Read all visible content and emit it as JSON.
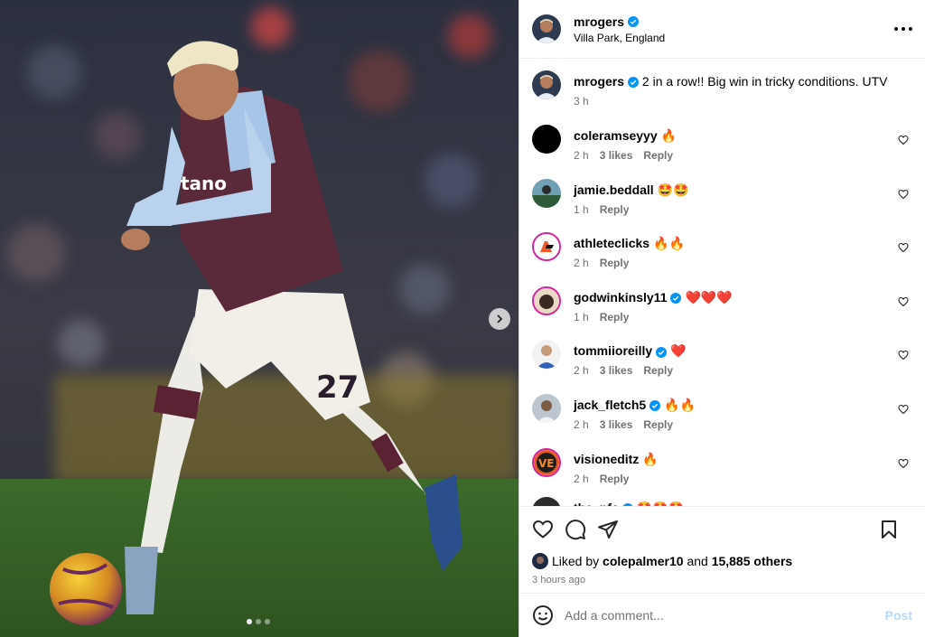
{
  "author": {
    "username": "mrogers",
    "location": "Villa Park, England",
    "verified": true
  },
  "caption": {
    "username": "mrogers",
    "text": "2 in a row!! Big win in tricky conditions. UTV",
    "time": "3 h"
  },
  "comments": [
    {
      "username": "coleramseyyy",
      "text": "🔥",
      "time": "2 h",
      "likes": "3 likes",
      "reply": "Reply",
      "verified": false
    },
    {
      "username": "jamie.beddall",
      "text": "🤩🤩",
      "time": "1 h",
      "likes": "",
      "reply": "Reply",
      "verified": false
    },
    {
      "username": "athleteclicks",
      "text": "🔥🔥",
      "time": "2 h",
      "likes": "",
      "reply": "Reply",
      "verified": false
    },
    {
      "username": "godwinkinsly11",
      "text": "❤️❤️❤️",
      "time": "1 h",
      "likes": "",
      "reply": "Reply",
      "verified": true
    },
    {
      "username": "tommiioreilly",
      "text": "❤️",
      "time": "2 h",
      "likes": "3 likes",
      "reply": "Reply",
      "verified": true
    },
    {
      "username": "jack_fletch5",
      "text": "🔥🔥",
      "time": "2 h",
      "likes": "3 likes",
      "reply": "Reply",
      "verified": true
    },
    {
      "username": "visioneditz",
      "text": "🔥",
      "time": "2 h",
      "likes": "",
      "reply": "Reply",
      "verified": false
    }
  ],
  "partial_comment": {
    "username": "the_pfc",
    "text": "🤩🤩🤩"
  },
  "likes_summary": {
    "prefix": "Liked by",
    "user": "colepalmer10",
    "joiner": "and",
    "others": "15,885 others",
    "posted_ago": "3 hours ago"
  },
  "add_comment": {
    "placeholder": "Add a comment...",
    "post_label": "Post"
  },
  "carousel": {
    "total": 3,
    "current": 1
  },
  "colors": {
    "verified_blue": "#0095f6",
    "muted_text": "#737373",
    "post_disabled": "#b3dbff",
    "divider": "#efefef"
  },
  "icons": {
    "more": "more-icon",
    "heart": "heart-icon",
    "comment": "comment-icon",
    "share": "share-icon",
    "save": "save-icon",
    "emoji": "emoji-icon",
    "next": "chevron-right-icon"
  }
}
